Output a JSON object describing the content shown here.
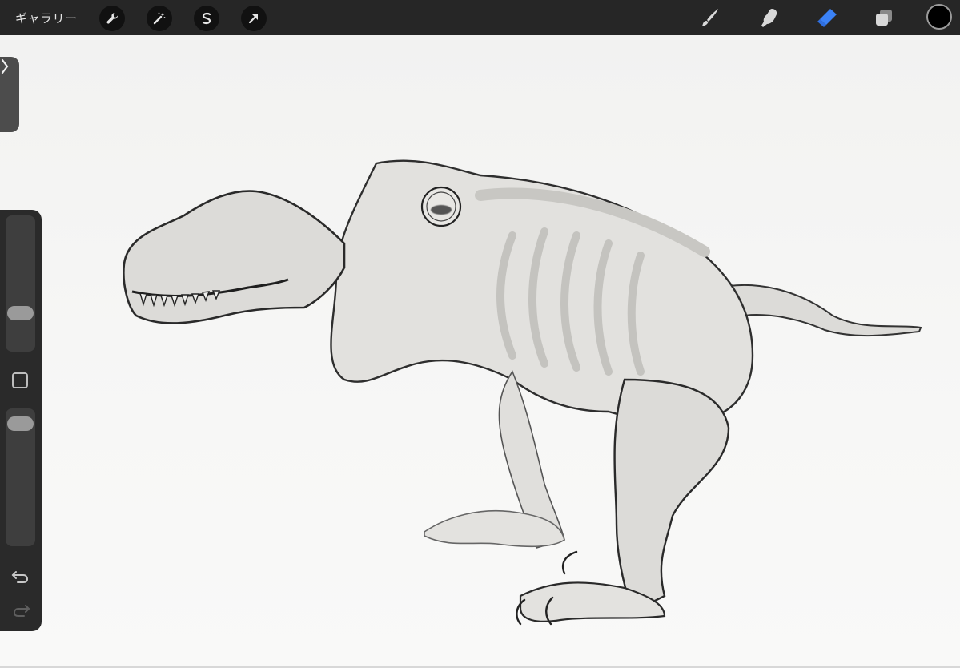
{
  "topbar": {
    "gallery_label": "ギャラリー",
    "left_tools": [
      {
        "name": "actions",
        "icon": "wrench-icon"
      },
      {
        "name": "adjustments",
        "icon": "magic-wand-icon"
      },
      {
        "name": "selection",
        "icon": "selection-s-icon"
      },
      {
        "name": "transform",
        "icon": "arrow-cursor-icon"
      }
    ],
    "right_tools": [
      {
        "name": "brush",
        "icon": "brush-icon"
      },
      {
        "name": "smudge",
        "icon": "smudge-finger-icon"
      },
      {
        "name": "eraser",
        "icon": "eraser-icon",
        "active": true
      },
      {
        "name": "layers",
        "icon": "layers-icon"
      }
    ],
    "current_color": "#000000",
    "accent_color": "#3b82f6"
  },
  "sidebar": {
    "brush_size_level": 0.25,
    "opacity_level": 0.05,
    "toggle_icon": "chevron-right-icon",
    "undo_icon": "undo-icon",
    "redo_icon": "redo-icon"
  },
  "canvas": {
    "artwork": "dinosaur-skeleton-sketch-image"
  }
}
